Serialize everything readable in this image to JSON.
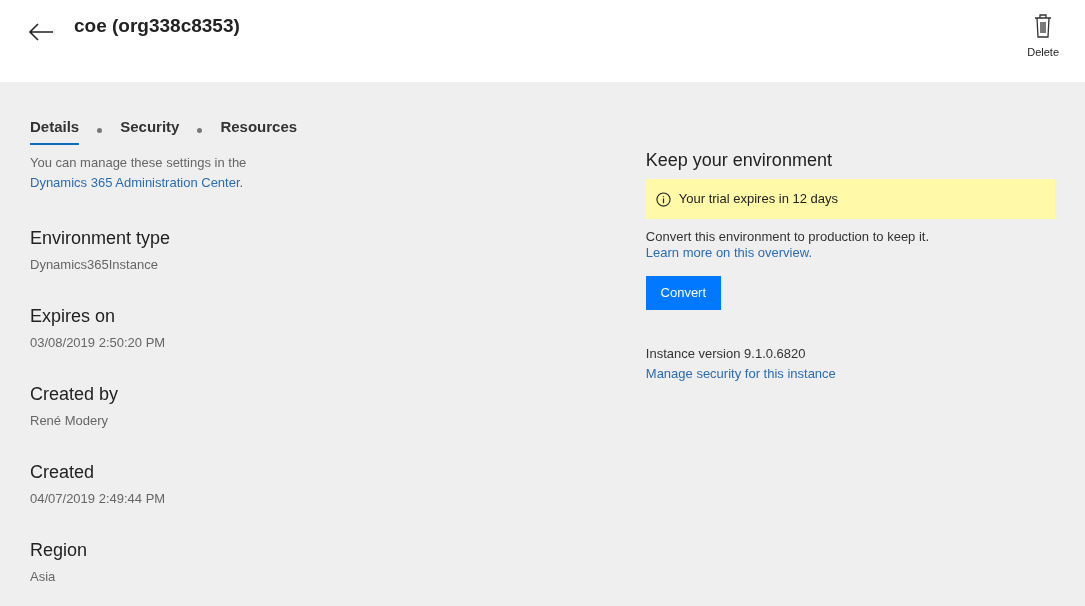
{
  "header": {
    "title": "coe (org338c8353)",
    "delete_label": "Delete"
  },
  "tabs": [
    {
      "label": "Details",
      "selected": true
    },
    {
      "label": "Security",
      "selected": false
    },
    {
      "label": "Resources",
      "selected": false
    }
  ],
  "intro": {
    "text": "You can manage these settings in the ",
    "link": "Dynamics 365 Administration Center",
    "after": "."
  },
  "fields": [
    {
      "label": "Environment type",
      "value": "Dynamics365Instance"
    },
    {
      "label": "Expires on",
      "value": "03/08/2019 2:50:20 PM"
    },
    {
      "label": "Created by",
      "value": "René Modery"
    },
    {
      "label": "Created",
      "value": "04/07/2019 2:49:44 PM"
    },
    {
      "label": "Region",
      "value": "Asia"
    }
  ],
  "keep": {
    "title": "Keep your environment",
    "notice": "Your trial expires in 12 days",
    "text": "Convert this environment to production to keep it. ",
    "link": "Learn more on this overview.",
    "button": "Convert",
    "version": "Instance version 9.1.0.6820",
    "security_link": "Manage security for this instance"
  }
}
